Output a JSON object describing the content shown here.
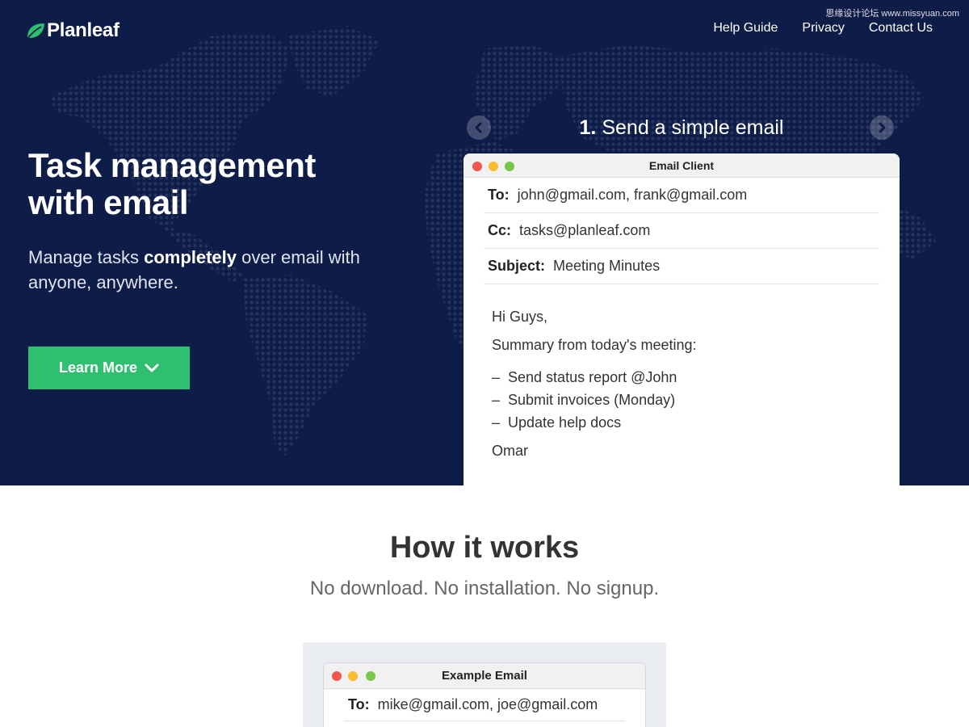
{
  "header": {
    "logo_text": "Planleaf",
    "watermark": "思缘设计论坛 www.missyuan.com",
    "nav": [
      "Help Guide",
      "Privacy",
      "Contact Us"
    ]
  },
  "hero": {
    "title_line1": "Task management",
    "title_line2": "with email",
    "subtitle_before": "Manage tasks ",
    "subtitle_bold": "completely",
    "subtitle_after": " over email with anyone, anywhere.",
    "cta_label": "Learn More"
  },
  "carousel": {
    "step_number": "1.",
    "step_text": "Send a simple email"
  },
  "email_client": {
    "window_title": "Email Client",
    "to_label": "To:",
    "to_value": "john@gmail.com, frank@gmail.com",
    "cc_label": "Cc:",
    "cc_value": "tasks@planleaf.com",
    "subject_label": "Subject:",
    "subject_value": "Meeting Minutes",
    "greeting": "Hi Guys,",
    "intro": "Summary from today's meeting:",
    "items": [
      "Send status report @John",
      "Submit invoices (Monday)",
      "Update help docs"
    ],
    "dash": "–",
    "signature": "Omar"
  },
  "how_it_works": {
    "title": "How it works",
    "subtitle": "No download. No installation. No signup."
  },
  "example_email": {
    "window_title": "Example Email",
    "to_label": "To:",
    "to_value": "mike@gmail.com, joe@gmail.com"
  },
  "colors": {
    "hero_bg": "#0e1c48",
    "accent_green": "#2fbf71",
    "map_dot": "#24335e"
  },
  "icons": [
    "leaf-icon",
    "chevron-down-icon",
    "chevron-left-icon",
    "chevron-right-icon",
    "world-map-dots"
  ]
}
